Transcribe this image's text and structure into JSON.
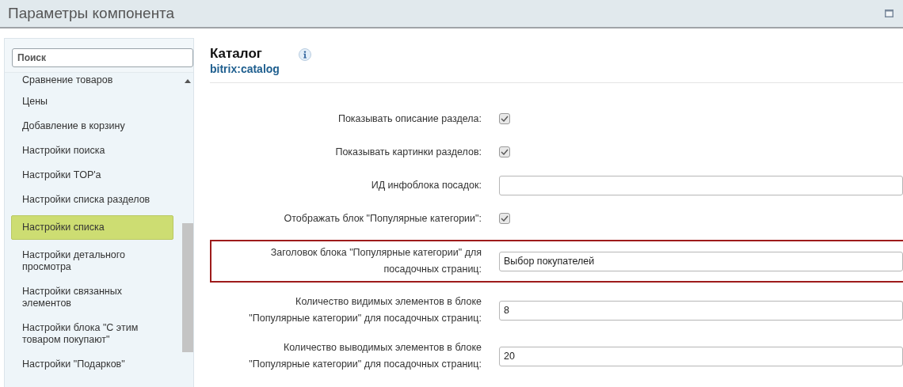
{
  "window": {
    "title": "Параметры компонента"
  },
  "sidebar": {
    "search": {
      "placeholder": "Поиск"
    },
    "items": [
      {
        "label": "Сравнение товаров",
        "selected": false
      },
      {
        "label": "Цены",
        "selected": false
      },
      {
        "label": "Добавление в корзину",
        "selected": false
      },
      {
        "label": "Настройки поиска",
        "selected": false
      },
      {
        "label": "Настройки TOP'a",
        "selected": false
      },
      {
        "label": "Настройки списка разделов",
        "selected": false
      },
      {
        "label": "Настройки списка",
        "selected": true
      },
      {
        "label": "Настройки детального просмотра",
        "selected": false
      },
      {
        "label": "Настройки связанных элементов",
        "selected": false
      },
      {
        "label": "Настройки блока \"С этим товаром покупают\"",
        "selected": false
      },
      {
        "label": "Настройки \"Подарков\"",
        "selected": false
      }
    ]
  },
  "component": {
    "name": "Каталог",
    "code": "bitrix:catalog"
  },
  "params": [
    {
      "kind": "checkbox",
      "label": "Показывать описание раздела:",
      "checked": true,
      "highlighted": false
    },
    {
      "kind": "checkbox",
      "label": "Показывать картинки разделов:",
      "checked": true,
      "highlighted": false
    },
    {
      "kind": "text",
      "label": "ИД инфоблока посадок:",
      "highlighted": false
    },
    {
      "kind": "checkbox",
      "label": "Отображать блок \"Популярные категории\":",
      "checked": true,
      "highlighted": false
    },
    {
      "kind": "text",
      "label": "Заголовок блока \"Популярные категории\" для посадочных страниц:",
      "value": "Выбор покупателей",
      "highlighted": true
    },
    {
      "kind": "text",
      "label": "Количество видимых элементов в блоке \"Популярные категории\" для посадочных страниц:",
      "value": "8",
      "highlighted": false
    },
    {
      "kind": "text",
      "label": "Количество выводимых элементов в блоке \"Популярные категории\" для посадочных страниц:",
      "value": "20",
      "highlighted": false
    }
  ]
}
